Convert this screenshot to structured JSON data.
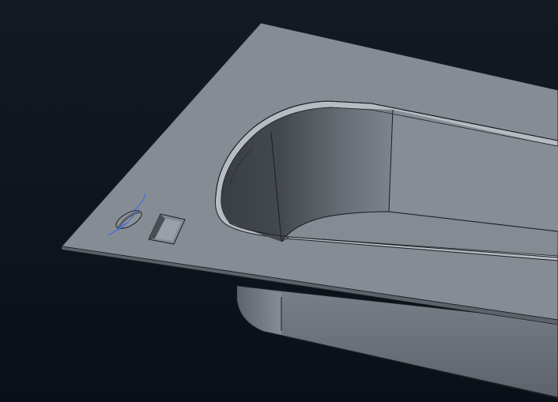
{
  "viewport": {
    "background_top": "#141a22",
    "background_bottom": "#0b1018"
  },
  "model": {
    "part": "bathtub",
    "colors": {
      "rim_top": "#868c94",
      "rim_edge": "#6e747c",
      "basin_wall_dark": "#3a3e45",
      "basin_wall_mid": "#5a5f67",
      "basin_floor": "#858b93",
      "outer_skirt": "#6f757d",
      "outer_skirt_dark": "#5c6169",
      "edge_line": "#1c1f24",
      "highlight": "#c9ced4",
      "selection_blue": "#3f6fd8"
    },
    "features": [
      {
        "name": "oval-hole",
        "selected": true
      },
      {
        "name": "rectangular-slot",
        "selected": false
      }
    ]
  }
}
